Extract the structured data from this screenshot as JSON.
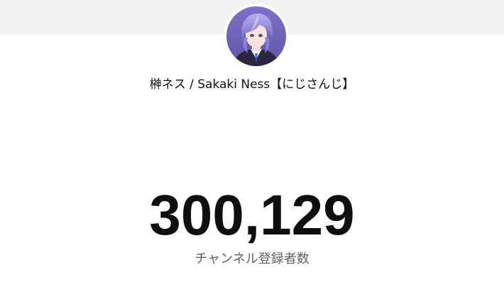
{
  "channel": {
    "name": "榊ネス / Sakaki Ness【にじさんじ】",
    "avatar_icon": "channel-avatar-image"
  },
  "stats": {
    "subscriber_count": "300,129",
    "subscriber_label": "チャンネル登録者数"
  },
  "colors": {
    "header_band": "#f2f2f2",
    "count_text": "#0f0f0f",
    "label_text": "#606060",
    "avatar_background": "#8a7fd0",
    "avatar_hair": "#9b8fe0"
  }
}
